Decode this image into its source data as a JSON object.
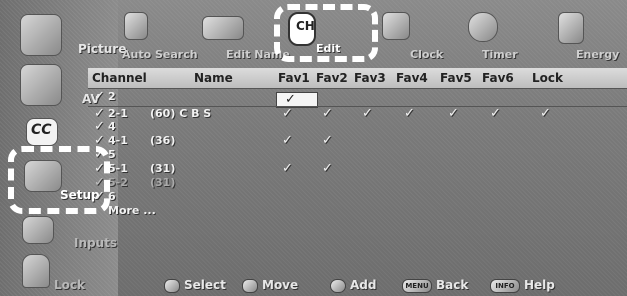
{
  "sidebar": {
    "items": [
      {
        "label": "Picture"
      },
      {
        "label": "AV"
      },
      {
        "label": "CC"
      },
      {
        "label": "Setup"
      },
      {
        "label": "Inputs"
      },
      {
        "label": "Lock"
      }
    ]
  },
  "tabs": [
    {
      "label": "Auto Search"
    },
    {
      "label": "Edit Name"
    },
    {
      "label": "Edit",
      "icon_text": "CH"
    },
    {
      "label": "Clock"
    },
    {
      "label": "Timer"
    },
    {
      "label": "Energy"
    }
  ],
  "table": {
    "columns": [
      "Channel",
      "Name",
      "Fav1",
      "Fav2",
      "Fav3",
      "Fav4",
      "Fav5",
      "Fav6",
      "Lock"
    ],
    "rows": [
      {
        "channel": "2",
        "name": "",
        "favs": [
          true,
          false,
          false,
          false,
          false,
          false
        ],
        "lock": false,
        "dim": false,
        "selected": true
      },
      {
        "channel": "2-1",
        "name": "(60)  C B S",
        "favs": [
          true,
          true,
          true,
          true,
          true,
          true
        ],
        "lock": true,
        "dim": false,
        "selected": false
      },
      {
        "channel": "4",
        "name": "",
        "favs": [
          false,
          false,
          false,
          false,
          false,
          false
        ],
        "lock": false,
        "dim": false,
        "selected": false
      },
      {
        "channel": "4-1",
        "name": "(36)",
        "favs": [
          true,
          true,
          false,
          false,
          false,
          false
        ],
        "lock": false,
        "dim": false,
        "selected": false
      },
      {
        "channel": "5",
        "name": "",
        "favs": [
          false,
          false,
          false,
          false,
          false,
          false
        ],
        "lock": false,
        "dim": false,
        "selected": false
      },
      {
        "channel": "5-1",
        "name": "(31)",
        "favs": [
          true,
          true,
          false,
          false,
          false,
          false
        ],
        "lock": false,
        "dim": false,
        "selected": false
      },
      {
        "channel": "5-2",
        "name": "(31)",
        "favs": [
          false,
          false,
          false,
          false,
          false,
          false
        ],
        "lock": false,
        "dim": true,
        "selected": false
      },
      {
        "channel": "6",
        "name": "",
        "favs": [
          false,
          false,
          false,
          false,
          false,
          false
        ],
        "lock": false,
        "dim": false,
        "selected": false
      }
    ],
    "more_label": "More ...",
    "check_glyph": "✓"
  },
  "footer": {
    "select": "Select",
    "move": "Move",
    "add": "Add",
    "back_key": "MENU",
    "back": "Back",
    "help_key": "INFO",
    "help": "Help"
  }
}
